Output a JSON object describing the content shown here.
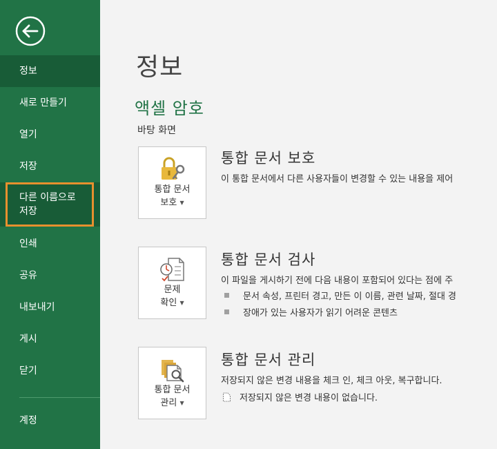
{
  "sidebar": {
    "items": [
      {
        "label": "정보"
      },
      {
        "label": "새로 만들기"
      },
      {
        "label": "열기"
      },
      {
        "label": "저장"
      },
      {
        "label_line1": "다른 이름으로",
        "label_line2": "저장"
      },
      {
        "label": "인쇄"
      },
      {
        "label": "공유"
      },
      {
        "label": "내보내기"
      },
      {
        "label": "게시"
      },
      {
        "label": "닫기"
      },
      {
        "label": "계정"
      }
    ]
  },
  "main": {
    "title": "정보",
    "file_name": "액셀 암호",
    "file_location": "바탕 화면",
    "sections": [
      {
        "button_line1": "통합 문서",
        "button_line2": "보호",
        "title": "통합 문서 보호",
        "description": "이 통합 문서에서 다른 사용자들이 변경할 수 있는 내용을 제어"
      },
      {
        "button_line1": "문제",
        "button_line2": "확인",
        "title": "통합 문서 검사",
        "description": "이 파일을 게시하기 전에 다음 내용이 포함되어 있다는 점에 주",
        "bullets": [
          "문서 속성, 프린터 경고, 만든 이 이름, 관련 날짜, 절대 경",
          "장애가 있는 사용자가 읽기 어려운 콘텐츠"
        ]
      },
      {
        "button_line1": "통합 문서",
        "button_line2": "관리",
        "title": "통합 문서 관리",
        "description": "저장되지 않은 변경 내용을 체크 인, 체크 아웃, 복구합니다.",
        "note": "저장되지 않은 변경 내용이 없습니다."
      }
    ]
  },
  "colors": {
    "sidebar_bg": "#217346",
    "sidebar_active": "#185c37",
    "highlight_outline": "#e8902e",
    "file_name": "#217346"
  }
}
